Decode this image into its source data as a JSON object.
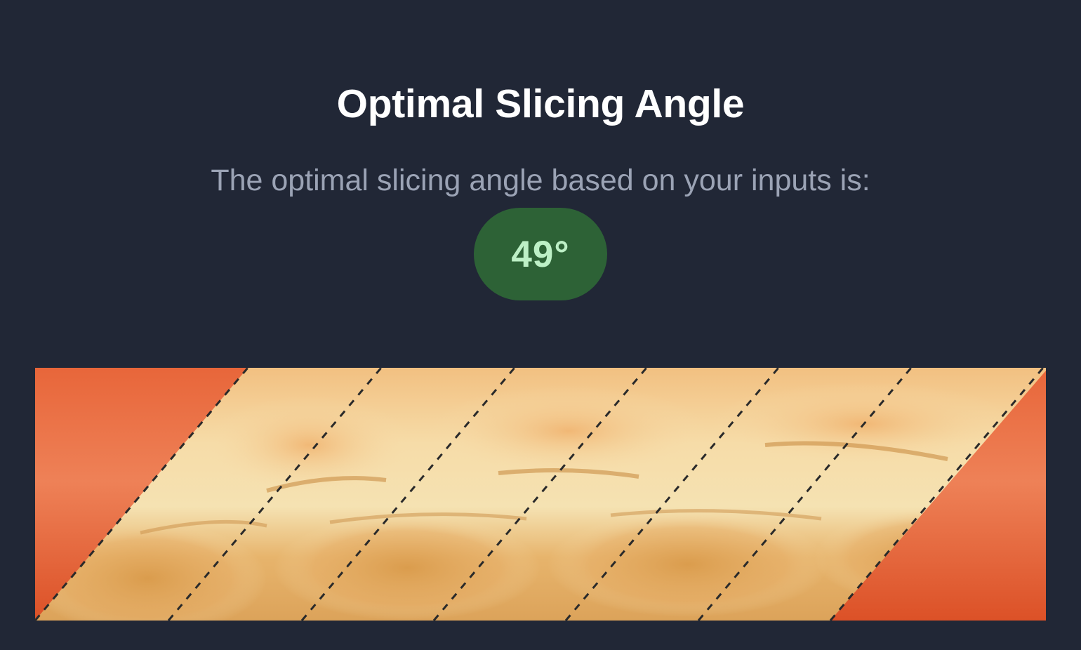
{
  "result": {
    "title": "Optimal Slicing Angle",
    "description": "The optimal slicing angle based on your inputs is:",
    "angle_display": "49°",
    "angle_degrees": 49,
    "accent_color": "#2d6236",
    "accent_text_color": "#bdf0c6"
  },
  "illustration": {
    "subject": "baguette-loaf",
    "cut_line_count": 7,
    "cut_line_style": "dashed",
    "background_color": "#e4592e"
  },
  "colors": {
    "page_background": "#212736",
    "title_text": "#ffffff",
    "subtitle_text": "#9ba3b5"
  }
}
